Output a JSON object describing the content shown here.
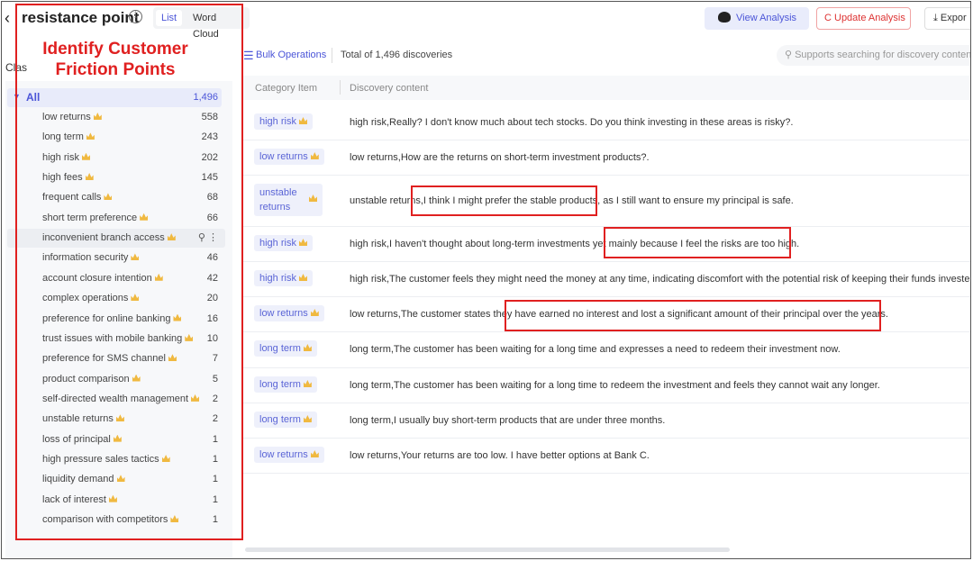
{
  "header": {
    "title": "resistance point",
    "toggle": {
      "list_label": "List",
      "wordcloud_label": "Word Cloud"
    },
    "view_analysis_label": "View Analysis",
    "update_analysis_label": "C Update Analysis",
    "export_label": "Expor"
  },
  "callout": {
    "line1": "Identify Customer",
    "line2": "Friction Points"
  },
  "sidebar": {
    "section_label": "Clas",
    "all": {
      "label": "All",
      "count": "1,496"
    },
    "items": [
      {
        "label": "low returns",
        "count": "558"
      },
      {
        "label": "long term",
        "count": "243"
      },
      {
        "label": "high risk",
        "count": "202"
      },
      {
        "label": "high fees",
        "count": "145"
      },
      {
        "label": "frequent calls",
        "count": "68"
      },
      {
        "label": "short term preference",
        "count": "66"
      },
      {
        "label": "inconvenient branch access",
        "count": ""
      },
      {
        "label": "information security",
        "count": "46"
      },
      {
        "label": "account closure intention",
        "count": "42"
      },
      {
        "label": "complex operations",
        "count": "20"
      },
      {
        "label": "preference for online banking",
        "count": "16"
      },
      {
        "label": "trust issues with mobile banking",
        "count": "10"
      },
      {
        "label": "preference for SMS channel",
        "count": "7"
      },
      {
        "label": "product comparison",
        "count": "5"
      },
      {
        "label": "self-directed wealth management",
        "count": "2"
      },
      {
        "label": "unstable returns",
        "count": "2"
      },
      {
        "label": "loss of principal",
        "count": "1"
      },
      {
        "label": "high pressure sales tactics",
        "count": "1"
      },
      {
        "label": "liquidity demand",
        "count": "1"
      },
      {
        "label": "lack of interest",
        "count": "1"
      },
      {
        "label": "comparison with competitors",
        "count": "1"
      }
    ]
  },
  "toolbar": {
    "bulk_label": "Bulk Operations",
    "total_text": "Total of 1,496 discoveries",
    "search_placeholder": "Supports searching for discovery content"
  },
  "table": {
    "columns": [
      "Category Item",
      "Discovery content"
    ],
    "rows": [
      {
        "category": "high risk",
        "content": "high risk,Really? I don't know much about tech stocks. Do you think investing in these areas is risky?."
      },
      {
        "category": "low returns",
        "content": "low returns,How are the returns on short-term investment products?."
      },
      {
        "category": "unstable returns",
        "content": "unstable returns,I think I might prefer the stable products, as I still want to ensure my principal is safe."
      },
      {
        "category": "high risk",
        "content": "high risk,I haven't thought about long-term investments yet mainly because I feel the risks are too high."
      },
      {
        "category": "high risk",
        "content": "high risk,The customer feels they might need the money at any time, indicating discomfort with the potential risk of keeping their funds invested."
      },
      {
        "category": "low returns",
        "content": "low returns,The customer states they have earned no interest and lost a significant amount of their principal over the years."
      },
      {
        "category": "long term",
        "content": "long term,The customer has been waiting for a long time and expresses a need to redeem their investment now."
      },
      {
        "category": "long term",
        "content": "long term,The customer has been waiting for a long time to redeem the investment and feels they cannot wait any longer."
      },
      {
        "category": "long term",
        "content": "long term,I usually buy short-term products that are under three months."
      },
      {
        "category": "low returns",
        "content": "low returns,Your returns are too low. I have better options at Bank C."
      }
    ]
  },
  "colors": {
    "accent": "#4b55d8",
    "highlight": "#e02020",
    "tag_bg": "#eef0fb"
  }
}
